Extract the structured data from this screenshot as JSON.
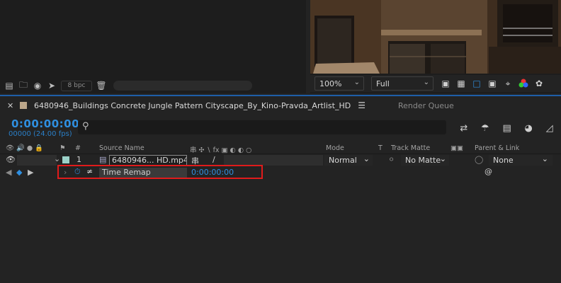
{
  "project_footer": {
    "bit_depth": "8 bpc",
    "icons": [
      "interpret-footage-icon",
      "folder-icon",
      "composition-icon",
      "flowchart-icon",
      "trash-icon"
    ]
  },
  "viewer": {
    "zoom": "100%",
    "resolution": "Full",
    "toolbar_icons": [
      "snapshot-icon",
      "transparency-grid-icon",
      "region-of-interest-icon",
      "mask-visibility-icon",
      "safe-margins-icon",
      "channel-icon",
      "exposure-reset-icon"
    ]
  },
  "timeline": {
    "tab_title": "6480946_Buildings Concrete Jungle Pattern Cityscape_By_Kino-Pravda_Artlist_HD",
    "render_queue": "Render Queue",
    "timecode": "0:00:00:00",
    "frames": "00000 (24.00 fps)",
    "search_placeholder": "",
    "columns": {
      "hash": "#",
      "source_name": "Source Name",
      "mode": "Mode",
      "t": "T",
      "track_matte": "Track Matte",
      "parent_link": "Parent & Link"
    },
    "layer": {
      "number": "1",
      "source_name": "6480946... HD.mp4",
      "mode": "Normal",
      "track_matte": "No Matte",
      "parent": "None",
      "label_color": "#9bd1c8"
    },
    "property": {
      "name": "Time Remap",
      "value": "0:00:00:00"
    }
  },
  "colors": {
    "accent_blue": "#2f8fe0",
    "highlight_red": "#e01b1b"
  }
}
